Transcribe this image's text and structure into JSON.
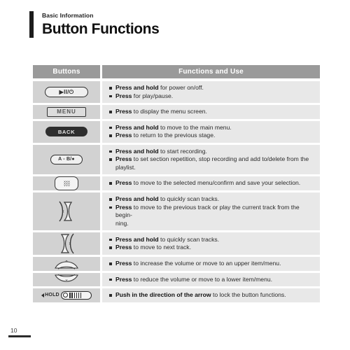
{
  "header": {
    "eyebrow": "Basic Information",
    "title": "Button Functions"
  },
  "table": {
    "columns": {
      "buttons": "Buttons",
      "functions": "Functions and Use"
    },
    "rows": [
      {
        "button": {
          "type": "pill-power",
          "glyph": "▶II/⏻",
          "name": "play-pause-power-button"
        },
        "lines": [
          {
            "bold": "Press and hold",
            "rest": " for power on/off."
          },
          {
            "bold": "Press",
            "rest": " for play/pause."
          }
        ]
      },
      {
        "button": {
          "type": "menu",
          "label": "MENU",
          "name": "menu-button"
        },
        "lines": [
          {
            "bold": "Press",
            "rest": " to display the menu screen."
          }
        ]
      },
      {
        "button": {
          "type": "back",
          "label": "BACK",
          "name": "back-button"
        },
        "lines": [
          {
            "bold": "Press and hold",
            "rest": " to move to the main menu."
          },
          {
            "bold": "Press",
            "rest": " to return to the previous stage."
          }
        ]
      },
      {
        "button": {
          "type": "ab",
          "label": "A - B/●",
          "name": "a-b-record-button"
        },
        "lines": [
          {
            "bold": "Press and hold",
            "rest": " to start recording."
          },
          {
            "bold": "Press",
            "rest": " to set section repetition, stop recording and add to/delete from the playlist."
          }
        ]
      },
      {
        "button": {
          "type": "select",
          "name": "select-confirm-button"
        },
        "lines": [
          {
            "bold": "Press",
            "rest": " to move to the selected menu/confirm and save your selection."
          }
        ]
      },
      {
        "button": {
          "type": "prev",
          "glyph": "‹",
          "name": "previous-track-button"
        },
        "lines": [
          {
            "bold": "Press and hold",
            "rest": " to quickly scan tracks."
          },
          {
            "bold": "Press",
            "rest": " to move to the previous track or play the current track from the begin-",
            "cont": "ning."
          }
        ]
      },
      {
        "button": {
          "type": "next",
          "glyph": "›",
          "name": "next-track-button"
        },
        "lines": [
          {
            "bold": "Press and hold",
            "rest": " to quickly scan tracks."
          },
          {
            "bold": "Press",
            "rest": " to move to next track."
          }
        ]
      },
      {
        "button": {
          "type": "vol-up",
          "glyph": "⌃",
          "name": "volume-up-button"
        },
        "lines": [
          {
            "bold": "Press",
            "rest": " to increase the volume or move to an upper item/menu."
          }
        ]
      },
      {
        "button": {
          "type": "vol-down",
          "glyph": "⌄",
          "name": "volume-down-button"
        },
        "lines": [
          {
            "bold": "Press",
            "rest": " to reduce the volume or move to a lower item/menu."
          }
        ]
      },
      {
        "button": {
          "type": "hold",
          "label": "HOLD",
          "name": "hold-switch"
        },
        "lines": [
          {
            "bold": "Push in the direction of the arrow",
            "rest": " to lock the button functions."
          }
        ]
      }
    ]
  },
  "footer": {
    "page_number": "10"
  },
  "colors": {
    "header_bar": "#1c1c1c",
    "table_header_bg": "#9a9a9a",
    "button_cell_bg": "#d2d2d2",
    "desc_cell_bg": "#e8e8e8",
    "text": "#2b2b2b"
  }
}
